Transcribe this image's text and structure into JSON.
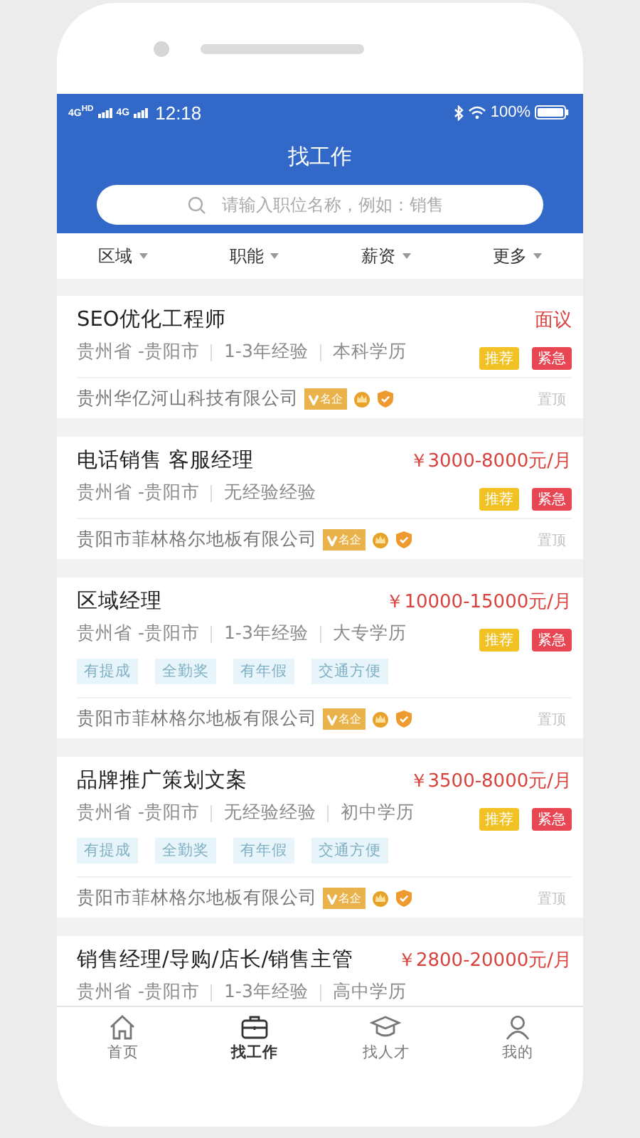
{
  "status_bar": {
    "network": [
      "4G$^{HD}$",
      "4G"
    ],
    "time": "12:18",
    "battery": "100%"
  },
  "header": {
    "title": "找工作"
  },
  "search": {
    "placeholder": "请输入职位名称，例如：销售"
  },
  "filters": [
    {
      "label": "区域"
    },
    {
      "label": "职能"
    },
    {
      "label": "薪资"
    },
    {
      "label": "更多"
    }
  ],
  "jobs": [
    {
      "title": "SEO优化工程师",
      "salary": "面议",
      "meta": [
        "贵州省 -贵阳市",
        "1-3年经验",
        "本科学历"
      ],
      "badges": [
        {
          "kind": "recommend",
          "label": "推荐"
        },
        {
          "kind": "urgent",
          "label": "紧急"
        }
      ],
      "company": "贵州华亿河山科技有限公司",
      "company_badge": "名企",
      "pin": "置顶"
    },
    {
      "title": "电话销售 客服经理",
      "salary": "￥3000-8000元/月",
      "meta": [
        "贵州省 -贵阳市",
        "无经验经验"
      ],
      "badges": [
        {
          "kind": "recommend",
          "label": "推荐"
        },
        {
          "kind": "urgent",
          "label": "紧急"
        }
      ],
      "company": "贵阳市菲林格尔地板有限公司",
      "company_badge": "名企",
      "pin": "置顶"
    },
    {
      "title": "区域经理",
      "salary": "￥10000-15000元/月",
      "meta": [
        "贵州省 -贵阳市",
        "1-3年经验",
        "大专学历"
      ],
      "badges": [
        {
          "kind": "recommend",
          "label": "推荐"
        },
        {
          "kind": "urgent",
          "label": "紧急"
        }
      ],
      "perks": [
        "有提成",
        "全勤奖",
        "有年假",
        "交通方便"
      ],
      "company": "贵阳市菲林格尔地板有限公司",
      "company_badge": "名企",
      "pin": "置顶"
    },
    {
      "title": "品牌推广策划文案",
      "salary": "￥3500-8000元/月",
      "meta": [
        "贵州省 -贵阳市",
        "无经验经验",
        "初中学历"
      ],
      "badges": [
        {
          "kind": "recommend",
          "label": "推荐"
        },
        {
          "kind": "urgent",
          "label": "紧急"
        }
      ],
      "perks": [
        "有提成",
        "全勤奖",
        "有年假",
        "交通方便"
      ],
      "company": "贵阳市菲林格尔地板有限公司",
      "company_badge": "名企",
      "pin": "置顶"
    },
    {
      "title": "销售经理/导购/店长/销售主管",
      "salary": "￥2800-20000元/月",
      "meta": [
        "贵州省 -贵阳市",
        "1-3年经验",
        "高中学历"
      ]
    }
  ],
  "tab_bar": [
    {
      "kind": "home",
      "label": "首页",
      "selected": false
    },
    {
      "kind": "briefcase",
      "label": "找工作",
      "selected": true
    },
    {
      "kind": "cap",
      "label": "找人才",
      "selected": false
    },
    {
      "kind": "person",
      "label": "我的",
      "selected": false
    }
  ]
}
